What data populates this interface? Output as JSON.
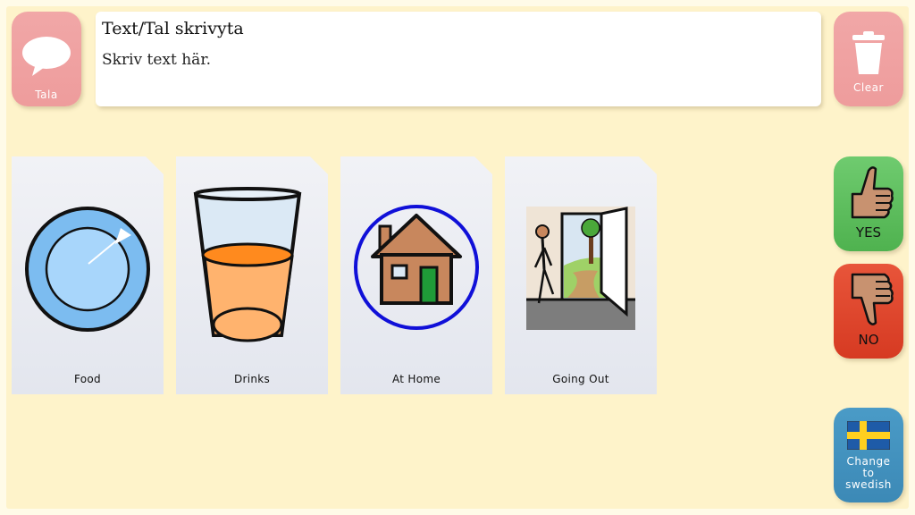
{
  "speak_button": {
    "label": "Tala",
    "icon": "speech-bubble-icon"
  },
  "clear_button": {
    "label": "Clear",
    "icon": "trash-icon"
  },
  "text_area": {
    "title": "Text/Tal skrivyta",
    "placeholder": "Skriv text här."
  },
  "categories": [
    {
      "label": "Food",
      "icon": "plate-icon"
    },
    {
      "label": "Drinks",
      "icon": "glass-icon"
    },
    {
      "label": "At Home",
      "icon": "house-icon"
    },
    {
      "label": "Going Out",
      "icon": "door-icon"
    }
  ],
  "yes_button": {
    "label": "YES",
    "icon": "thumbs-up-icon"
  },
  "no_button": {
    "label": "NO",
    "icon": "thumbs-down-icon"
  },
  "language_button": {
    "line1": "Change",
    "line2": "to",
    "line3": "swedish",
    "icon": "swedish-flag-icon"
  },
  "colors": {
    "background": "#fef3ca",
    "speak_clear": "#ee9c9c",
    "yes": "#5dbd5d",
    "no": "#dd4429",
    "language": "#4493c0"
  }
}
